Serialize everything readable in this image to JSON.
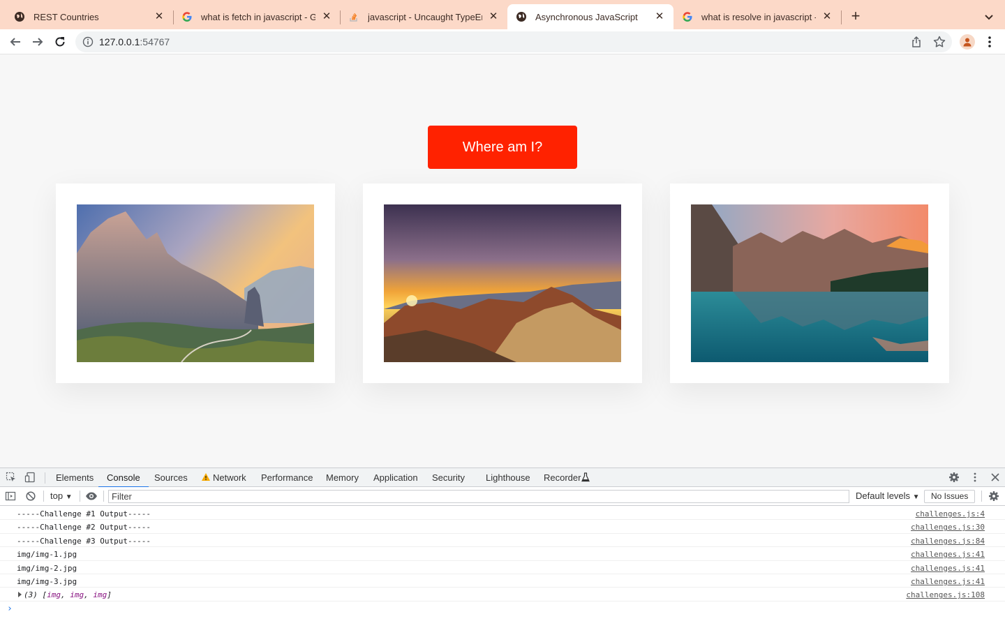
{
  "browser": {
    "tabs": [
      {
        "title": "REST Countries",
        "icon": "globe-icon",
        "active": false
      },
      {
        "title": "what is fetch in javascript - Goo",
        "icon": "google-icon",
        "active": false
      },
      {
        "title": "javascript - Uncaught TypeError",
        "icon": "stackoverflow-icon",
        "active": false
      },
      {
        "title": "Asynchronous JavaScript",
        "icon": "globe-icon",
        "active": true
      },
      {
        "title": "what is resolve in javascript - G",
        "icon": "google-icon",
        "active": false
      }
    ],
    "url_host": "127.0.0.1",
    "url_port": ":54767"
  },
  "page": {
    "button_label": "Where am I?",
    "images": [
      {
        "name": "dolomites-mountain-sunset"
      },
      {
        "name": "canyon-sunset"
      },
      {
        "name": "moraine-lake-mountains"
      }
    ]
  },
  "devtools": {
    "tabs": [
      "Elements",
      "Console",
      "Sources",
      "Network",
      "Performance",
      "Memory",
      "Application",
      "Security",
      "Lighthouse",
      "Recorder"
    ],
    "active_tab": "Console",
    "context": "top",
    "filter_placeholder": "Filter",
    "levels": "Default levels",
    "issues": "No Issues",
    "console": [
      {
        "msg": "-----Challenge #1 Output-----",
        "src": "challenges.js:4"
      },
      {
        "msg": "-----Challenge #2 Output-----",
        "src": "challenges.js:30"
      },
      {
        "msg": "-----Challenge #3 Output-----",
        "src": "challenges.js:84"
      },
      {
        "msg": "img/img-1.jpg",
        "src": "challenges.js:41"
      },
      {
        "msg": "img/img-2.jpg",
        "src": "challenges.js:41"
      },
      {
        "msg": "img/img-3.jpg",
        "src": "challenges.js:41"
      }
    ],
    "array_log": {
      "count": "(3)",
      "open": "[",
      "items": [
        "img",
        "img",
        "img"
      ],
      "close": "]",
      "src": "challenges.js:108"
    },
    "prompt": "›"
  }
}
